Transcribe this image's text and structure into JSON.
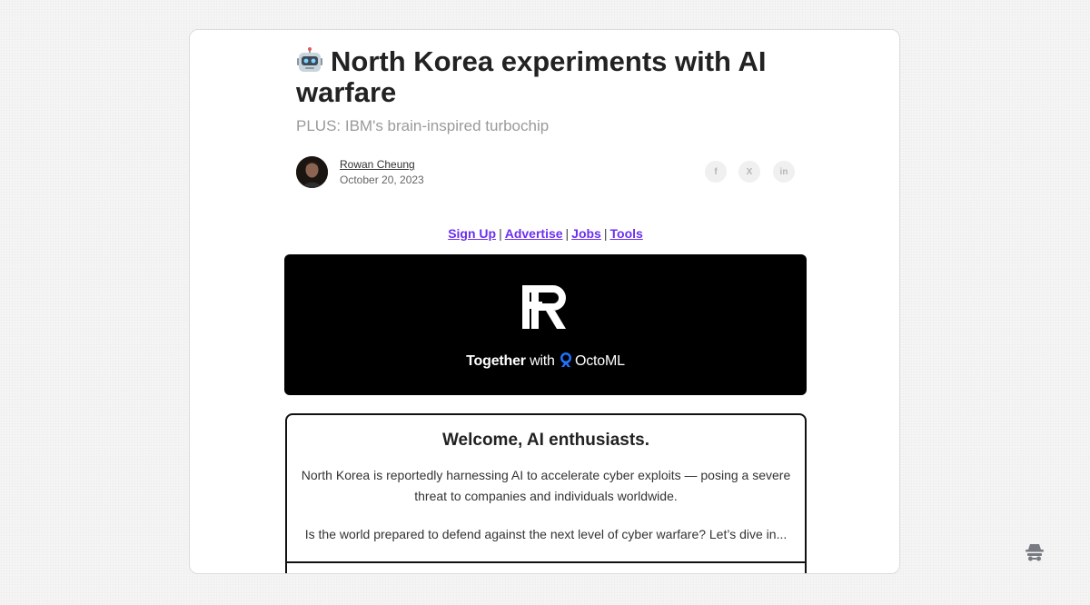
{
  "article": {
    "emoji": "robot-emoji",
    "title": "North Korea experiments with AI warfare",
    "subtitle": "PLUS: IBM's brain-inspired turbochip",
    "author": "Rowan Cheung",
    "date": "October 20, 2023"
  },
  "share": {
    "facebook": "f",
    "x": "X",
    "linkedin": "in"
  },
  "nav_links": {
    "signup": "Sign Up",
    "advertise": "Advertise",
    "jobs": "Jobs",
    "tools": "Tools",
    "separator": "|"
  },
  "banner": {
    "together_prefix": "Together",
    "together_with": "with",
    "sponsor": "OctoML"
  },
  "welcome": {
    "title": "Welcome, AI enthusiasts.",
    "paragraph1": "North Korea is reportedly harnessing AI to accelerate cyber exploits — posing a severe threat to companies and individuals worldwide.",
    "paragraph2": "Is the world prepared to defend against the next level of cyber warfare? Let’s dive in..."
  },
  "colors": {
    "link": "#6b2ff0",
    "banner_bg": "#000000",
    "octo_blue": "#1e73ff"
  }
}
